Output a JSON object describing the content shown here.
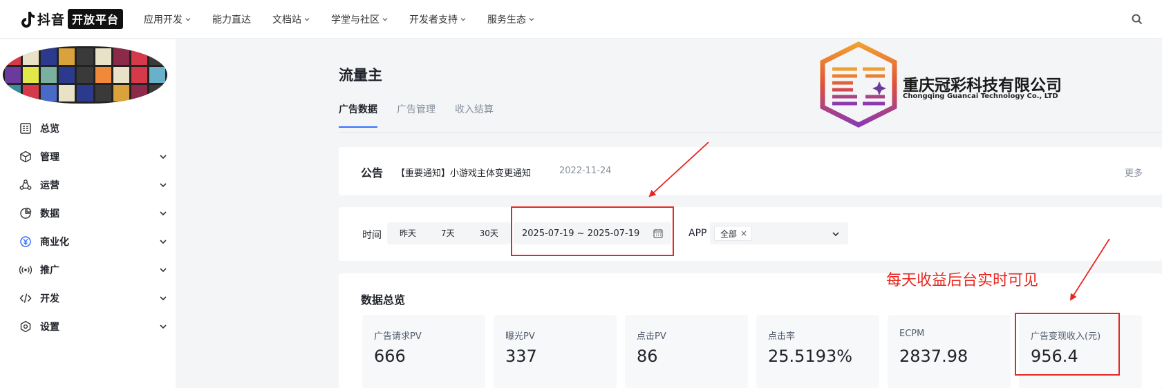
{
  "topnav": {
    "logo_word": "抖音",
    "logo_badge": "开放平台",
    "items": [
      {
        "label": "应用开发",
        "has_chevron": true
      },
      {
        "label": "能力直达",
        "has_chevron": false
      },
      {
        "label": "文档站",
        "has_chevron": true
      },
      {
        "label": "学堂与社区",
        "has_chevron": true
      },
      {
        "label": "开发者支持",
        "has_chevron": true
      },
      {
        "label": "服务生态",
        "has_chevron": true
      }
    ],
    "search_icon": "search-icon"
  },
  "sidebar": {
    "items": [
      {
        "label": "总览",
        "icon": "overview-icon"
      },
      {
        "label": "管理",
        "icon": "cube-icon"
      },
      {
        "label": "运营",
        "icon": "operation-icon"
      },
      {
        "label": "数据",
        "icon": "pie-chart-icon"
      },
      {
        "label": "商业化",
        "icon": "yen-icon"
      },
      {
        "label": "推广",
        "icon": "broadcast-icon"
      },
      {
        "label": "开发",
        "icon": "code-icon"
      },
      {
        "label": "设置",
        "icon": "settings-icon"
      }
    ]
  },
  "main": {
    "page_title": "流量主",
    "tabs": [
      {
        "label": "广告数据",
        "active": true
      },
      {
        "label": "广告管理",
        "active": false
      },
      {
        "label": "收入结算",
        "active": false
      }
    ]
  },
  "watermark": {
    "company_cn": "重庆冠彩科技有限公司",
    "company_en": "Chongqing Guancai Technology Co., LTD"
  },
  "notice": {
    "title": "公告",
    "text": "【重要通知】小游戏主体变更通知",
    "date": "2022-11-24",
    "more": "更多"
  },
  "filters": {
    "time_label": "时间",
    "quick_ranges": [
      "昨天",
      "7天",
      "30天"
    ],
    "date_range": "2025-07-19 ~ 2025-07-19",
    "app_label": "APP",
    "app_selected": "全部",
    "tag_close": "×"
  },
  "overview": {
    "title": "数据总览",
    "metrics": [
      {
        "label": "广告请求PV",
        "value": "666"
      },
      {
        "label": "曝光PV",
        "value": "337"
      },
      {
        "label": "点击PV",
        "value": "86"
      },
      {
        "label": "点击率",
        "value": "25.5193%"
      },
      {
        "label": "ECPM",
        "value": "2837.98"
      },
      {
        "label": "广告变现收入(元)",
        "value": "956.4"
      }
    ]
  },
  "annotation": {
    "text": "每天收益后台实时可见",
    "color": "#e8261f"
  },
  "colors": {
    "accent": "#3370ff",
    "annotation_red": "#e8261f"
  }
}
